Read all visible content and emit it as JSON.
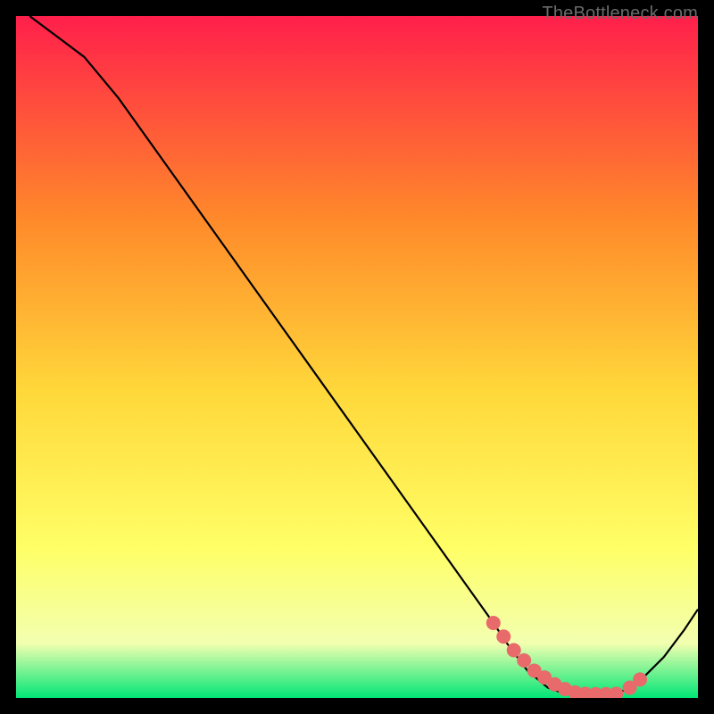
{
  "watermark": "TheBottleneck.com",
  "colors": {
    "frame": "#000000",
    "line": "#000000",
    "dot_fill": "#e86a6a",
    "dot_stroke": "#e86a6a",
    "grad_top": "#ff1f4b",
    "grad_mid1": "#ff8a2a",
    "grad_mid2": "#ffd83a",
    "grad_mid3": "#ffff66",
    "grad_mid4": "#f2ffb0",
    "grad_bottom": "#00e676"
  },
  "chart_data": {
    "type": "line",
    "title": "",
    "xlabel": "",
    "ylabel": "",
    "xlim": [
      0,
      100
    ],
    "ylim": [
      0,
      100
    ],
    "series": [
      {
        "name": "curve",
        "x": [
          2,
          4,
          6,
          10,
          15,
          20,
          25,
          30,
          35,
          40,
          45,
          50,
          55,
          60,
          65,
          70,
          72,
          75,
          78,
          80,
          82,
          85,
          88,
          90,
          92,
          95,
          98,
          100
        ],
        "values": [
          100,
          98.5,
          97,
          94,
          88,
          81,
          74,
          67,
          60,
          53,
          46,
          39,
          32,
          25,
          18,
          11,
          8,
          4,
          1.5,
          0.8,
          0.5,
          0.5,
          0.6,
          1.5,
          3,
          6,
          10,
          13
        ]
      }
    ],
    "markers": {
      "name": "highlight-band",
      "x": [
        70,
        71.5,
        73,
        74.5,
        76,
        77.5,
        79,
        80.5,
        82,
        83.5,
        85,
        86.5,
        88,
        90,
        91.5
      ],
      "values": [
        11,
        9,
        7,
        5.5,
        4,
        3,
        2,
        1.3,
        0.8,
        0.6,
        0.55,
        0.55,
        0.6,
        1.5,
        2.7
      ]
    }
  }
}
